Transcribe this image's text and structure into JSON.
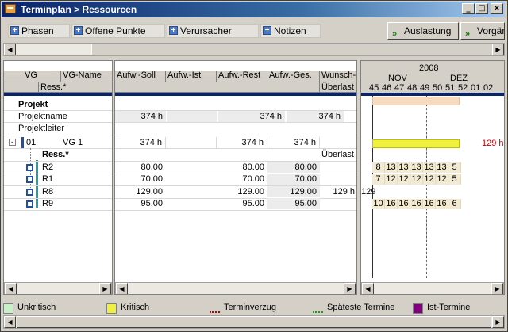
{
  "window": {
    "title": "Terminplan > Ressourcen",
    "btn_min": "_",
    "btn_max": "□",
    "btn_close": "×"
  },
  "toolbar": {
    "tabs": [
      "Phasen",
      "Offene Punkte",
      "Verursacher",
      "Notizen"
    ],
    "auslastung": "Auslastung",
    "vorgaenge": "Vorgän",
    "arrow": "»"
  },
  "grid_left": {
    "col_vg": "VG",
    "col_vgname": "VG-Name",
    "col_ress": "Ress.*",
    "rows": {
      "projekt": "Projekt",
      "projektname": "Projektname",
      "projektleiter": "Projektleiter",
      "vg_nr": "01",
      "vg_name": "VG 1",
      "ress_header": "Ress.*",
      "resources": [
        "R2",
        "R1",
        "R8",
        "R9"
      ]
    }
  },
  "grid_mid": {
    "cols": [
      "Aufw.-Soll",
      "Aufw.-Ist",
      "Aufw.-Rest",
      "Aufw.-Ges.",
      "Wunsch-",
      "Überlast"
    ],
    "projektname_vals": [
      "374 h",
      "",
      "374 h",
      "374 h"
    ],
    "vg_vals": [
      "374 h",
      "",
      "374 h",
      "374 h"
    ],
    "ueberlast_label": "Überlast",
    "resources": [
      {
        "soll": "80.00",
        "ist": "",
        "rest": "80.00",
        "ges": "80.00",
        "wunsch": ""
      },
      {
        "soll": "70.00",
        "ist": "",
        "rest": "70.00",
        "ges": "70.00",
        "wunsch": ""
      },
      {
        "soll": "129.00",
        "ist": "",
        "rest": "129.00",
        "ges": "129.00",
        "wunsch": "129 h"
      },
      {
        "soll": "95.00",
        "ist": "",
        "rest": "95.00",
        "ges": "95.00",
        "wunsch": ""
      }
    ]
  },
  "gantt": {
    "year": "2008",
    "months": [
      "NOV",
      "DEZ"
    ],
    "weeks": [
      "45",
      "46",
      "47",
      "48",
      "49",
      "50",
      "51",
      "52",
      "01",
      "02"
    ],
    "overflow_label": "129 h",
    "r8_prefix": "129",
    "resource_loads": [
      [
        "8",
        "13",
        "13",
        "13",
        "13",
        "13",
        "5"
      ],
      [
        "7",
        "12",
        "12",
        "12",
        "12",
        "12",
        "5"
      ],
      [
        "",
        "",
        "",
        "",
        "",
        "",
        ""
      ],
      [
        "10",
        "16",
        "16",
        "16",
        "16",
        "16",
        "6"
      ]
    ],
    "colors": {
      "projekt_bar": "#f5dcc0",
      "kritisch": "#f0f040",
      "cell_bg": "#f2ead2"
    }
  },
  "legend": {
    "items": [
      {
        "label": "Unkritisch",
        "color": "#c8f0c8"
      },
      {
        "label": "Kritisch",
        "color": "#f0f040"
      },
      {
        "label": "Terminverzug",
        "color": "#c00000"
      },
      {
        "label": "Späteste Termine",
        "color": "#10a010"
      },
      {
        "label": "Ist-Termine",
        "color": "#800080"
      }
    ]
  }
}
